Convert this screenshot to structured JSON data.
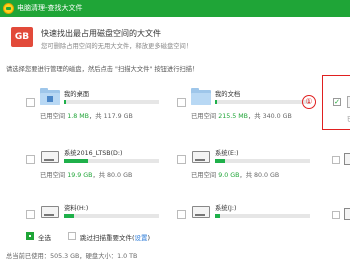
{
  "window": {
    "title": "电脑清理-查找大文件"
  },
  "header": {
    "icon_text": "GB",
    "title": "快速找出最占用磁盘空间的大文件",
    "subtitle": "您可删除占用空间的无用大文件，释放更多磁盘空间！"
  },
  "prompt": "请选择您要进行管理的磁盘，然后点击 \"扫描大文件\" 按钮进行扫描！",
  "drives": [
    {
      "name": "我的桌面",
      "used_prefix": "已用空间 ",
      "used": "1.8 MB",
      "total_sep": "，共 ",
      "total": "117.9 GB",
      "used_fraction": 0.02,
      "icon": "desktop-folder-icon"
    },
    {
      "name": "我的文档",
      "used_prefix": "已用空间 ",
      "used": "215.5 MB",
      "total_sep": "，共 ",
      "total": "340.0 GB",
      "used_fraction": 0.02,
      "icon": "documents-folder-icon"
    },
    {
      "name": "系统2016_LTSB(D:)",
      "used_prefix": "已用空间 ",
      "used": "19.9 GB",
      "total_sep": "，共 ",
      "total": "80.0 GB",
      "used_fraction": 0.25,
      "icon": "hard-drive-icon"
    },
    {
      "name": "系统(E:)",
      "used_prefix": "已用空间 ",
      "used": "9.0 GB",
      "total_sep": "，共 ",
      "total": "80.0 GB",
      "used_fraction": 0.11,
      "icon": "hard-drive-icon"
    },
    {
      "name": "资料(H:)",
      "used_fraction": 0.1,
      "icon": "hard-drive-icon"
    },
    {
      "name": "系统(J:)",
      "used_fraction": 0.05,
      "icon": "hard-drive-icon"
    }
  ],
  "annotation": {
    "number": "①",
    "checkmark": "✓",
    "partial_text": "已"
  },
  "footer": {
    "select_all": "全选",
    "skip_label": "跳过扫描重要文件(",
    "settings_link": "设置",
    "close_paren": ")"
  },
  "summary": "总当前已使用：505.3 GB，硬盘大小：1.0 TB",
  "colors": {
    "brand": "#1fa537",
    "accent_red": "#e02020",
    "bar_fill": "#1fb04a"
  }
}
